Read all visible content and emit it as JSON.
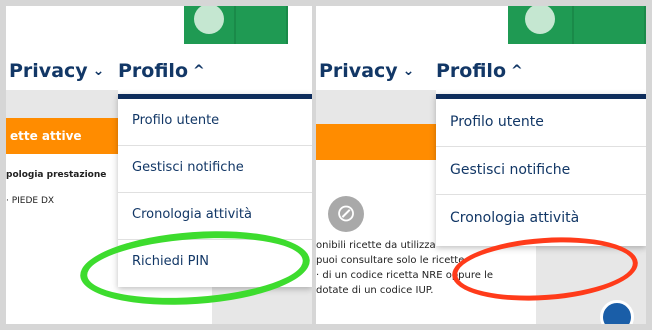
{
  "colors": {
    "nav_text": "#123766",
    "dropdown_border": "#0e2d5c",
    "orange_banner": "#ff8c00",
    "green_tile": "#1f9a53",
    "green_highlight": "#3ddc2e",
    "red_highlight": "#ff3b1a"
  },
  "left_panel": {
    "nav": {
      "privacy_label": "Privacy",
      "profile_label": "Profilo",
      "chevron_down": "⌄",
      "chevron_up": "^"
    },
    "banner_text": "ette attive",
    "line1": "pologia prestazione",
    "line2": "· PIEDE DX",
    "dropdown": [
      {
        "label": "Profilo utente"
      },
      {
        "label": "Gestisci notifiche"
      },
      {
        "label": "Cronologia attività"
      },
      {
        "label": "Richiedi PIN"
      }
    ]
  },
  "right_panel": {
    "nav": {
      "privacy_label": "Privacy",
      "profile_label": "Profilo",
      "chevron_down": "⌄",
      "chevron_up": "^"
    },
    "no_icon_glyph": "⊘",
    "body_lines": [
      "onibili ricette da utilizza",
      "puoi consultare solo le ricette",
      "· di un codice ricetta NRE oppure le",
      "dotate di un codice IUP."
    ],
    "dropdown": [
      {
        "label": "Profilo utente"
      },
      {
        "label": "Gestisci notifiche"
      },
      {
        "label": "Cronologia attività"
      }
    ]
  }
}
